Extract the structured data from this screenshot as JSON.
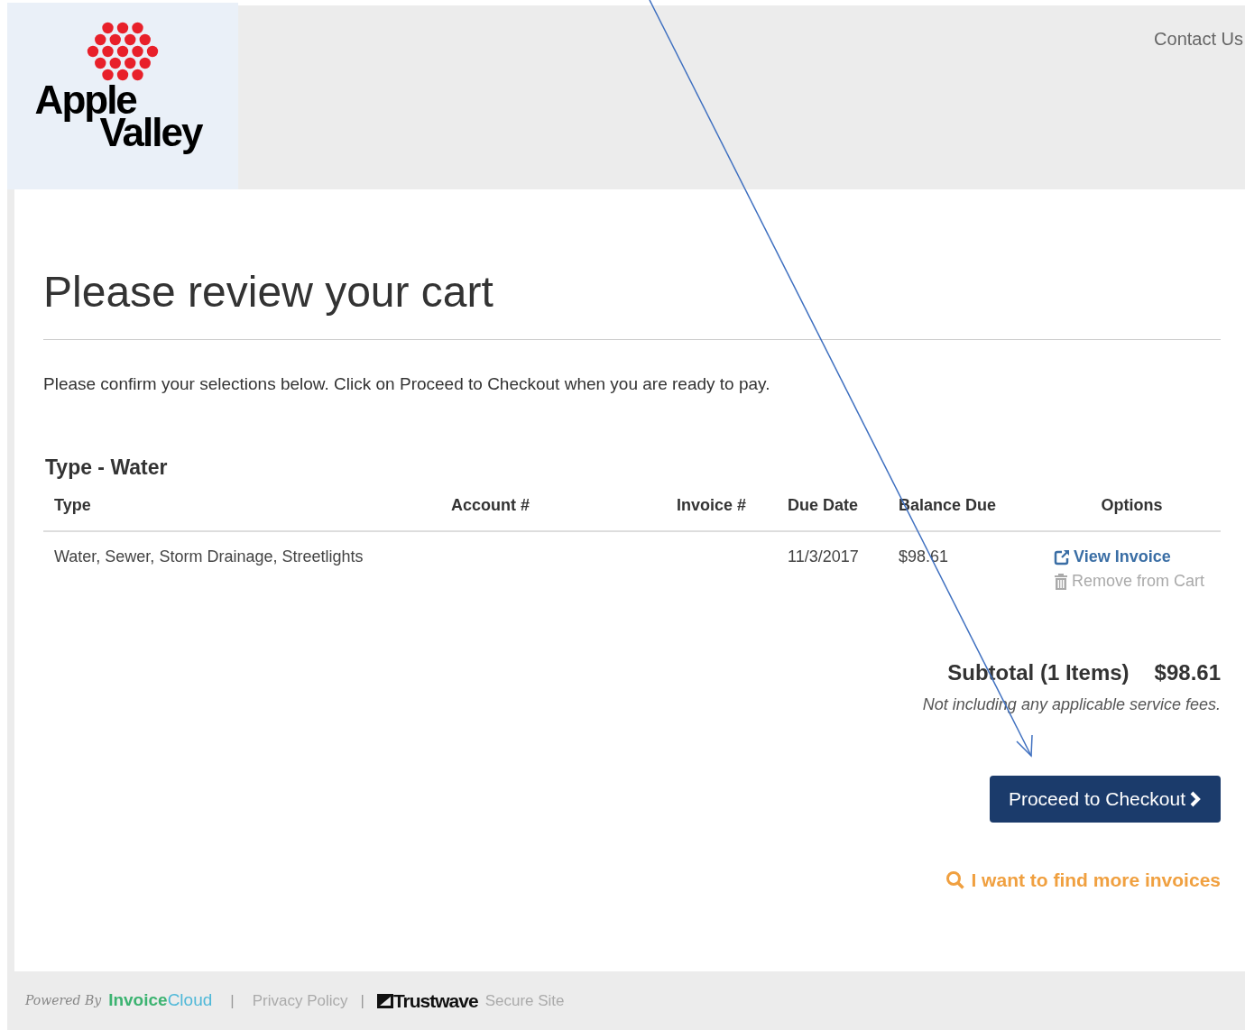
{
  "header": {
    "logo": {
      "line_1": "Apple",
      "line_2": "Valley"
    },
    "contact_link": "Contact Us"
  },
  "page": {
    "title": "Please review your cart",
    "intro": "Please confirm your selections below. Click on Proceed to Checkout when you are ready to pay."
  },
  "section": {
    "title": "Type - Water",
    "table": {
      "columns": [
        "Type",
        "Account #",
        "Invoice #",
        "Due Date",
        "Balance Due",
        "Options"
      ],
      "rows": [
        {
          "type": "Water, Sewer, Storm Drainage, Streetlights",
          "due_date": "11/3/2017",
          "balance_due": "$98.61",
          "options": [
            "View Invoice",
            "Remove from Cart"
          ]
        }
      ]
    }
  },
  "subtotal": {
    "label": "Subtotal (1 Items)",
    "amount": "$98.61",
    "note": "Not including any applicable service fees."
  },
  "checkout_button": "Proceed to Checkout",
  "find_more_link": "I want to find more invoices",
  "footer": {
    "powered_by": "Powered By",
    "brand_part_1": "Invoice",
    "brand_part_2": "Cloud",
    "separator_1": "|",
    "privacy": "Privacy Policy",
    "separator_2": "|",
    "trust_brand": "Trustwave",
    "trust_note": "Secure Site"
  }
}
